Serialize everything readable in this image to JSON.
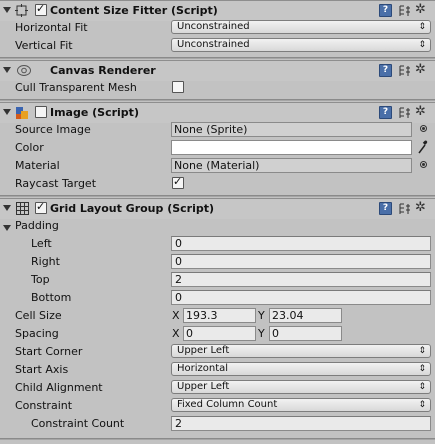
{
  "components": {
    "content_size_fitter": {
      "title": "Content Size Fitter (Script)",
      "horizontal_fit_label": "Horizontal Fit",
      "horizontal_fit_value": "Unconstrained",
      "vertical_fit_label": "Vertical Fit",
      "vertical_fit_value": "Unconstrained"
    },
    "canvas_renderer": {
      "title": "Canvas Renderer",
      "cull_label": "Cull Transparent Mesh"
    },
    "image": {
      "title": "Image (Script)",
      "source_image_label": "Source Image",
      "source_image_value": "None (Sprite)",
      "color_label": "Color",
      "material_label": "Material",
      "material_value": "None (Material)",
      "raycast_label": "Raycast Target"
    },
    "grid_layout": {
      "title": "Grid Layout Group (Script)",
      "padding_label": "Padding",
      "left_label": "Left",
      "left_value": "0",
      "right_label": "Right",
      "right_value": "0",
      "top_label": "Top",
      "top_value": "2",
      "bottom_label": "Bottom",
      "bottom_value": "0",
      "cell_size_label": "Cell Size",
      "cell_x_label": "X",
      "cell_x_value": "193.3",
      "cell_y_label": "Y",
      "cell_y_value": "23.04",
      "spacing_label": "Spacing",
      "spacing_x_label": "X",
      "spacing_x_value": "0",
      "spacing_y_label": "Y",
      "spacing_y_value": "0",
      "start_corner_label": "Start Corner",
      "start_corner_value": "Upper Left",
      "start_axis_label": "Start Axis",
      "start_axis_value": "Horizontal",
      "child_alignment_label": "Child Alignment",
      "child_alignment_value": "Upper Left",
      "constraint_label": "Constraint",
      "constraint_value": "Fixed Column Count",
      "constraint_count_label": "Constraint Count",
      "constraint_count_value": "2"
    }
  },
  "icons": {
    "help": "?",
    "dropdown_arrow": "⇕",
    "gear": "✲",
    "eyedropper": "eyedropper-icon"
  },
  "colors": {
    "panel_bg": "#c2c2c2",
    "header_bg": "#c6c6c6",
    "help_blue": "#4a6fa8"
  }
}
